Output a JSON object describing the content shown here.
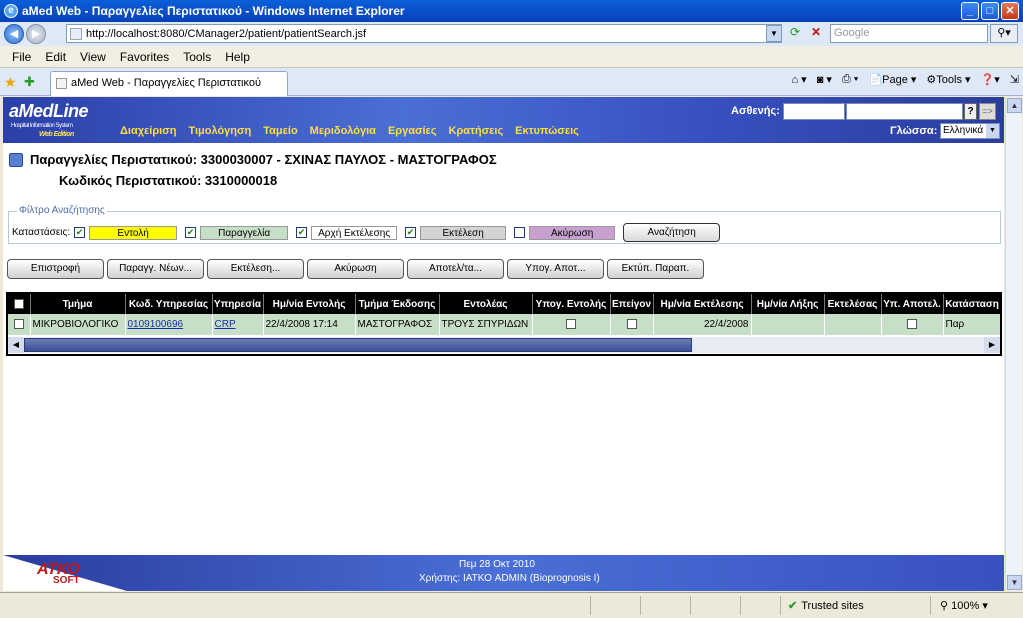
{
  "window": {
    "title": "aMed Web - Παραγγελίες Περιστατικού - Windows Internet Explorer",
    "controls": [
      "_",
      "□",
      "✕"
    ]
  },
  "browser": {
    "url": "http://localhost:8080/CManager2/patient/patientSearch.jsf",
    "search_placeholder": "Google",
    "menu": [
      "File",
      "Edit",
      "View",
      "Favorites",
      "Tools",
      "Help"
    ],
    "tab_title": "aMed Web - Παραγγελίες Περιστατικού",
    "toolbar": {
      "page": "Page",
      "tools": "Tools"
    },
    "status": {
      "zone": "Trusted sites",
      "zoom": "100%"
    }
  },
  "app": {
    "logo": "aMedLine",
    "logo_sub": "Hospital Information System",
    "logo_edition": "Web Edition",
    "nav": [
      "Διαχείριση",
      "Τιμολόγηση",
      "Ταμείο",
      "Μεριδολόγια",
      "Εργασίες",
      "Κρατήσεις",
      "Εκτυπώσεις"
    ],
    "patient_label": "Ασθενής:",
    "help_label": "?",
    "go_label": "=>",
    "language_label": "Γλώσσα:",
    "language_value": "Ελληνικά"
  },
  "header": {
    "line1": "Παραγγελίες Περιστατικού: 3300030007 - ΣΧΙΝΑΣ ΠΑΥΛΟΣ - ΜΑΣΤΟΓΡΑΦΟΣ",
    "line2": "Κωδικός Περιστατικού: 3310000018"
  },
  "filter": {
    "legend": "Φίλτρο Αναζήτησης",
    "states_label": "Καταστάσεις:",
    "states": [
      {
        "label": "Εντολή",
        "checked": true,
        "color": "#ffff00"
      },
      {
        "label": "Παραγγελία",
        "checked": true,
        "color": "#c6dfc6"
      },
      {
        "label": "Αρχή Εκτέλεσης",
        "checked": true,
        "color": "#ffffff"
      },
      {
        "label": "Εκτέλεση",
        "checked": true,
        "color": "#d3d3d3"
      },
      {
        "label": "Ακύρωση",
        "checked": false,
        "color": "#c8a0d0"
      }
    ],
    "search_button": "Αναζήτηση"
  },
  "actions": [
    "Επιστροφή",
    "Παραγγ. Νέων...",
    "Εκτέλεση...",
    "Ακύρωση",
    "Αποτελ/τα...",
    "Υπογ. Αποτ...",
    "Εκτύπ. Παραπ."
  ],
  "grid": {
    "columns": [
      "",
      "Τμήμα",
      "Κωδ. Υπηρεσίας",
      "Υπηρεσία",
      "Ημ/νία Εντολής",
      "Τμήμα Έκδοσης",
      "Εντολέας",
      "Υπογ. Εντολής",
      "Επείγον",
      "Ημ/νία Εκτέλεσης",
      "Ημ/νία Λήξης",
      "Εκτελέσας",
      "Υπ. Αποτελ.",
      "Κατάσταση"
    ],
    "rows": [
      [
        "",
        "ΜΙΚΡΟΒΙΟΛΟΓΙΚΟ",
        "0109100696",
        "CRP",
        "22/4/2008 17:14",
        "ΜΑΣΤΟΓΡΑΦΟΣ",
        "ΤΡΟΥΣ ΣΠΥΡΙΔΩΝ",
        "",
        "",
        "22/4/2008",
        "",
        "",
        "",
        "Παρ"
      ]
    ]
  },
  "footer": {
    "logo": "ΑΤΚΟ",
    "logo_sub": "SOFT",
    "date": "Πεμ 28 Οκτ 2010",
    "user": "Χρήστης: ΙΑΤΚΟ ADMIN (Bioprognosis I)"
  }
}
